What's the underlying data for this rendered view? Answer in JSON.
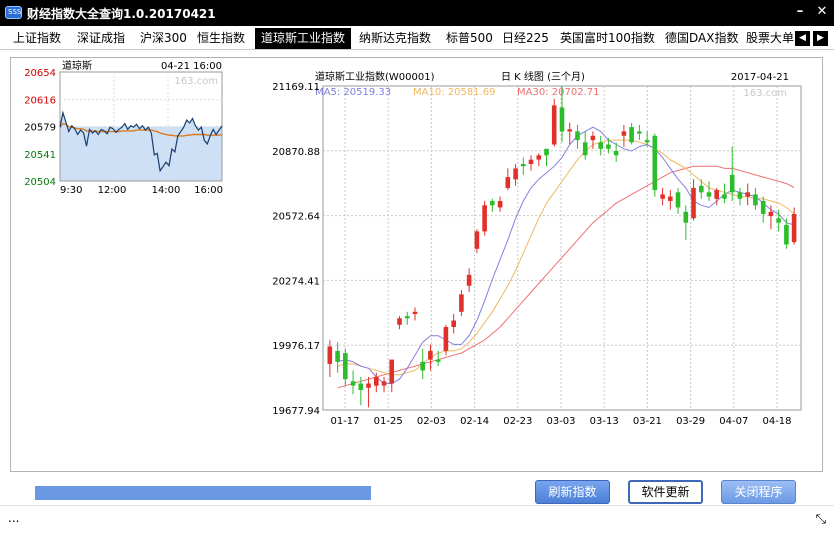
{
  "window": {
    "title": "财经指数大全查询1.0.20170421",
    "minimize_label": "–",
    "close_label": "✕"
  },
  "tabs": [
    {
      "label": "上证指数",
      "active": false
    },
    {
      "label": "深证成指",
      "active": false
    },
    {
      "label": "沪深300",
      "active": false
    },
    {
      "label": "恒生指数",
      "active": false
    },
    {
      "label": "道琼斯工业指数",
      "active": true
    },
    {
      "label": "纳斯达克指数",
      "active": false
    },
    {
      "label": "标普500",
      "active": false
    },
    {
      "label": "日经225",
      "active": false
    },
    {
      "label": "英国富时100指数",
      "active": false
    },
    {
      "label": "德国DAX指数",
      "active": false
    },
    {
      "label": "股票大单",
      "active": false
    }
  ],
  "tab_nav": {
    "prev": "◀",
    "next": "▶"
  },
  "intraday": {
    "name": "道琼斯",
    "datetime": "04-21 16:00",
    "watermark": "163.com",
    "colors": {
      "line": "#1b3f6e",
      "avg": "#e07a1a",
      "fill": "#cde0f5",
      "up": "#d00000",
      "down": "#0a7a0a"
    },
    "chart_data": {
      "type": "line",
      "y_ticks": [
        "20654",
        "20616",
        "20579",
        "20541",
        "20504"
      ],
      "x_ticks": [
        "9:30",
        "12:00",
        "14:00",
        "16:00"
      ],
      "ylim": [
        20504,
        20654
      ],
      "baseline": 20579,
      "series": [
        {
          "values": [
            20578,
            20598,
            20585,
            20572,
            20580,
            20576,
            20568,
            20574,
            20570,
            20552,
            20575,
            20570,
            20573,
            20568,
            20575,
            20573,
            20569,
            20578,
            20576,
            20571,
            20575,
            20578,
            20583,
            20575,
            20580,
            20578,
            20582,
            20576,
            20580,
            20574,
            20578,
            20570,
            20540,
            20542,
            20518,
            20524,
            20530,
            20525,
            20548,
            20544,
            20566,
            20572,
            20578,
            20588,
            20584,
            20590,
            20580,
            20574,
            20578,
            20560,
            20555,
            20566,
            20575,
            20568,
            20574,
            20580
          ]
        },
        {
          "values": [
            20578,
            20583,
            20582,
            20579,
            20578,
            20577,
            20576,
            20576,
            20575,
            20573,
            20573,
            20573,
            20573,
            20572,
            20572,
            20572,
            20572,
            20572,
            20572,
            20572,
            20572,
            20573,
            20573,
            20573,
            20573,
            20573,
            20574,
            20574,
            20574,
            20574,
            20574,
            20574,
            20573,
            20572,
            20570,
            20569,
            20568,
            20567,
            20567,
            20566,
            20566,
            20566,
            20566,
            20567,
            20567,
            20568,
            20568,
            20568,
            20568,
            20568,
            20567,
            20567,
            20567,
            20567,
            20567,
            20568
          ]
        }
      ]
    }
  },
  "daily": {
    "title": "道琼斯工业指数(W00001)",
    "period": "日 K 线图 (三个月)",
    "date": "2017-04-21",
    "watermark": "163.com",
    "legend": {
      "ma5": "MA5: 20519.33",
      "ma10": "MA10: 20581.69",
      "ma30": "MA30: 20702.71"
    },
    "colors": {
      "up": "#e0302a",
      "down": "#2bbd2b",
      "ma5": "#8080e0",
      "ma10": "#f0b860",
      "ma30": "#f07070",
      "grid": "#c8c8c8"
    },
    "chart_data": {
      "type": "candlestick",
      "y_ticks": [
        "21169.11",
        "20870.88",
        "20572.64",
        "20274.41",
        "19976.17",
        "19677.94"
      ],
      "x_ticks": [
        "01-17",
        "01-25",
        "02-03",
        "02-14",
        "02-23",
        "03-03",
        "03-13",
        "03-21",
        "03-29",
        "04-07",
        "04-18"
      ],
      "ylim": [
        19677.94,
        21169.11
      ],
      "candles": [
        {
          "o": 19890,
          "h": 19999,
          "l": 19830,
          "c": 19970
        },
        {
          "o": 19950,
          "h": 19990,
          "l": 19850,
          "c": 19900
        },
        {
          "o": 19940,
          "h": 19960,
          "l": 19790,
          "c": 19820
        },
        {
          "o": 19810,
          "h": 19860,
          "l": 19750,
          "c": 19790
        },
        {
          "o": 19800,
          "h": 19830,
          "l": 19700,
          "c": 19770
        },
        {
          "o": 19780,
          "h": 19830,
          "l": 19690,
          "c": 19800
        },
        {
          "o": 19790,
          "h": 19850,
          "l": 19760,
          "c": 19830
        },
        {
          "o": 19790,
          "h": 19830,
          "l": 19760,
          "c": 19810
        },
        {
          "o": 19800,
          "h": 19910,
          "l": 19760,
          "c": 19910
        },
        {
          "o": 20070,
          "h": 20110,
          "l": 20050,
          "c": 20100
        },
        {
          "o": 20110,
          "h": 20130,
          "l": 20070,
          "c": 20100
        },
        {
          "o": 20120,
          "h": 20150,
          "l": 20090,
          "c": 20130
        },
        {
          "o": 19900,
          "h": 19960,
          "l": 19820,
          "c": 19860
        },
        {
          "o": 19910,
          "h": 19980,
          "l": 19860,
          "c": 19950
        },
        {
          "o": 19910,
          "h": 19950,
          "l": 19880,
          "c": 19900
        },
        {
          "o": 19950,
          "h": 20070,
          "l": 19930,
          "c": 20060
        },
        {
          "o": 20060,
          "h": 20120,
          "l": 20030,
          "c": 20090
        },
        {
          "o": 20130,
          "h": 20230,
          "l": 20110,
          "c": 20210
        },
        {
          "o": 20250,
          "h": 20330,
          "l": 20220,
          "c": 20300
        },
        {
          "o": 20420,
          "h": 20510,
          "l": 20400,
          "c": 20500
        },
        {
          "o": 20500,
          "h": 20640,
          "l": 20480,
          "c": 20620
        },
        {
          "o": 20640,
          "h": 20650,
          "l": 20590,
          "c": 20620
        },
        {
          "o": 20610,
          "h": 20660,
          "l": 20590,
          "c": 20640
        },
        {
          "o": 20700,
          "h": 20790,
          "l": 20690,
          "c": 20750
        },
        {
          "o": 20740,
          "h": 20810,
          "l": 20710,
          "c": 20790
        },
        {
          "o": 20810,
          "h": 20840,
          "l": 20760,
          "c": 20800
        },
        {
          "o": 20810,
          "h": 20850,
          "l": 20780,
          "c": 20830
        },
        {
          "o": 20830,
          "h": 20860,
          "l": 20800,
          "c": 20850
        },
        {
          "o": 20880,
          "h": 20860,
          "l": 20800,
          "c": 20850
        },
        {
          "o": 20900,
          "h": 21110,
          "l": 20890,
          "c": 21080
        },
        {
          "o": 21070,
          "h": 21169,
          "l": 20910,
          "c": 20960
        },
        {
          "o": 20960,
          "h": 21000,
          "l": 20900,
          "c": 20970
        },
        {
          "o": 20960,
          "h": 20990,
          "l": 20880,
          "c": 20920
        },
        {
          "o": 20910,
          "h": 20960,
          "l": 20830,
          "c": 20850
        },
        {
          "o": 20920,
          "h": 20960,
          "l": 20880,
          "c": 20940
        },
        {
          "o": 20910,
          "h": 20940,
          "l": 20850,
          "c": 20880
        },
        {
          "o": 20900,
          "h": 20930,
          "l": 20860,
          "c": 20880
        },
        {
          "o": 20870,
          "h": 20910,
          "l": 20820,
          "c": 20850
        },
        {
          "o": 20940,
          "h": 20990,
          "l": 20890,
          "c": 20960
        },
        {
          "o": 20980,
          "h": 21000,
          "l": 20900,
          "c": 20910
        },
        {
          "o": 20960,
          "h": 20990,
          "l": 20920,
          "c": 20950
        },
        {
          "o": 20920,
          "h": 20960,
          "l": 20890,
          "c": 20910
        },
        {
          "o": 20940,
          "h": 20950,
          "l": 20660,
          "c": 20690
        },
        {
          "o": 20650,
          "h": 20700,
          "l": 20620,
          "c": 20670
        },
        {
          "o": 20640,
          "h": 20690,
          "l": 20600,
          "c": 20660
        },
        {
          "o": 20680,
          "h": 20700,
          "l": 20580,
          "c": 20610
        },
        {
          "o": 20590,
          "h": 20620,
          "l": 20460,
          "c": 20540
        },
        {
          "o": 20560,
          "h": 20740,
          "l": 20550,
          "c": 20700
        },
        {
          "o": 20710,
          "h": 20740,
          "l": 20650,
          "c": 20680
        },
        {
          "o": 20680,
          "h": 20730,
          "l": 20640,
          "c": 20660
        },
        {
          "o": 20650,
          "h": 20700,
          "l": 20620,
          "c": 20690
        },
        {
          "o": 20670,
          "h": 20720,
          "l": 20630,
          "c": 20650
        },
        {
          "o": 20760,
          "h": 20890,
          "l": 20640,
          "c": 20680
        },
        {
          "o": 20680,
          "h": 20700,
          "l": 20620,
          "c": 20650
        },
        {
          "o": 20660,
          "h": 20720,
          "l": 20620,
          "c": 20680
        },
        {
          "o": 20670,
          "h": 20700,
          "l": 20600,
          "c": 20620
        },
        {
          "o": 20640,
          "h": 20660,
          "l": 20540,
          "c": 20580
        },
        {
          "o": 20570,
          "h": 20620,
          "l": 20510,
          "c": 20590
        },
        {
          "o": 20560,
          "h": 20600,
          "l": 20500,
          "c": 20540
        },
        {
          "o": 20530,
          "h": 20560,
          "l": 20420,
          "c": 20440
        },
        {
          "o": 20450,
          "h": 20610,
          "l": 20440,
          "c": 20580
        }
      ],
      "ma5": [
        19900,
        19910,
        19900,
        19880,
        19870,
        19830,
        19800,
        19800,
        19820,
        19870,
        19930,
        19990,
        20020,
        20020,
        20000,
        19980,
        19980,
        20020,
        20090,
        20180,
        20280,
        20370,
        20460,
        20560,
        20640,
        20700,
        20740,
        20770,
        20800,
        20840,
        20900,
        20940,
        20960,
        20980,
        20960,
        20920,
        20900,
        20880,
        20870,
        20890,
        20900,
        20880,
        20840,
        20790,
        20740,
        20700,
        20640,
        20620,
        20610,
        20640,
        20670,
        20690,
        20680,
        20670,
        20660,
        20630,
        20600,
        20580,
        20540,
        20530
      ],
      "ma10": [
        19880,
        19890,
        19890,
        19880,
        19870,
        19860,
        19850,
        19840,
        19840,
        19850,
        19860,
        19890,
        19920,
        19940,
        19950,
        19950,
        19960,
        19990,
        20030,
        20080,
        20130,
        20190,
        20250,
        20320,
        20400,
        20480,
        20560,
        20630,
        20680,
        20730,
        20780,
        20830,
        20870,
        20900,
        20910,
        20920,
        20920,
        20920,
        20920,
        20910,
        20900,
        20880,
        20860,
        20830,
        20810,
        20790,
        20760,
        20730,
        20700,
        20690,
        20680,
        20670,
        20660,
        20660,
        20650,
        20650,
        20640,
        20630,
        20610,
        20581
      ],
      "ma30": [
        19780,
        19790,
        19800,
        19810,
        19820,
        19830,
        19840,
        19850,
        19860,
        19870,
        19880,
        19890,
        19900,
        19910,
        19920,
        19930,
        19940,
        19960,
        19980,
        20000,
        20030,
        20060,
        20100,
        20140,
        20180,
        20220,
        20260,
        20300,
        20340,
        20380,
        20420,
        20460,
        20500,
        20540,
        20570,
        20600,
        20630,
        20650,
        20670,
        20690,
        20710,
        20730,
        20750,
        20770,
        20780,
        20790,
        20800,
        20800,
        20800,
        20800,
        20790,
        20790,
        20780,
        20770,
        20760,
        20750,
        20740,
        20730,
        20720,
        20702
      ]
    }
  },
  "controls": {
    "refresh_label": "刷新指数",
    "update_label": "软件更新",
    "close_label": "关闭程序",
    "progress_percent": 100
  },
  "status": {
    "text": "...",
    "resize": "⤡"
  }
}
